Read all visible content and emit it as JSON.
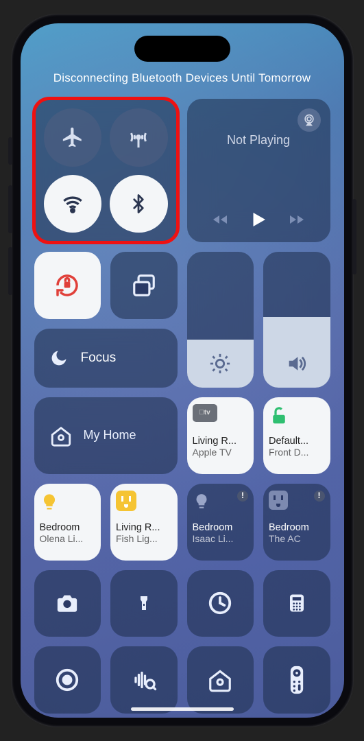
{
  "status_message": "Disconnecting Bluetooth Devices Until Tomorrow",
  "connectivity": {
    "airplane": {
      "on": false
    },
    "cellular": {
      "on": false
    },
    "wifi": {
      "on": true
    },
    "bluetooth": {
      "on": true
    }
  },
  "media": {
    "title": "Not Playing"
  },
  "rotation_lock": {
    "on": true,
    "color": "#e0403a"
  },
  "screen_mirroring": {
    "label": "Screen Mirroring"
  },
  "focus": {
    "label": "Focus"
  },
  "brightness": {
    "value_pct": 35
  },
  "volume": {
    "value_pct": 52
  },
  "home": {
    "label": "My Home"
  },
  "devices": [
    {
      "title": "Living R...",
      "sub": "Apple TV",
      "icon": "appletv",
      "on": true,
      "alert": false
    },
    {
      "title": "Default...",
      "sub": "Front D...",
      "icon": "lock-open",
      "on": true,
      "alert": false,
      "color": "#2fbf71"
    },
    {
      "title": "Bedroom",
      "sub": "Olena Li...",
      "icon": "bulb",
      "on": true,
      "alert": false,
      "color": "#f5c433"
    },
    {
      "title": "Living R...",
      "sub": "Fish Lig...",
      "icon": "outlet",
      "on": true,
      "alert": false,
      "color": "#f5c433"
    },
    {
      "title": "Bedroom",
      "sub": "Isaac Li...",
      "icon": "bulb",
      "on": false,
      "alert": true
    },
    {
      "title": "Bedroom",
      "sub": "The AC",
      "icon": "outlet",
      "on": false,
      "alert": true
    }
  ],
  "utilities_row1": [
    "camera",
    "flashlight",
    "timer",
    "calculator"
  ],
  "utilities_row2": [
    "screen-record",
    "sound-recognition",
    "home-shortcut",
    "apple-tv-remote"
  ]
}
